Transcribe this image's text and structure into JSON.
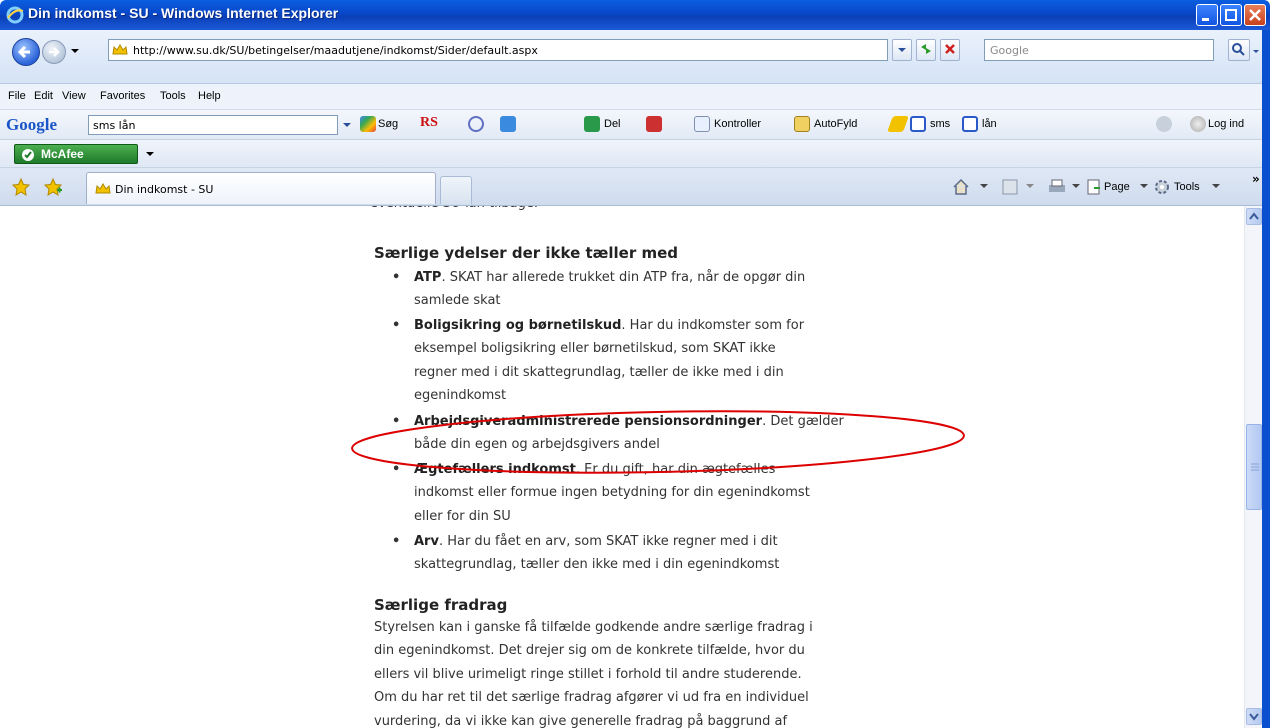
{
  "window": {
    "title": "Din indkomst - SU - Windows Internet Explorer"
  },
  "addressbar": {
    "url": "http://www.su.dk/SU/betingelser/maadutjene/indkomst/Sider/default.aspx",
    "search_placeholder": "Google"
  },
  "menubar": {
    "items": [
      "File",
      "Edit",
      "View",
      "Favorites",
      "Tools",
      "Help"
    ]
  },
  "google_toolbar": {
    "logo": "Google",
    "query": "sms lån",
    "items": [
      "Søg",
      "RS",
      "Del",
      "Kontroller",
      "AutoFyld",
      "sms",
      "lån",
      "Log ind"
    ]
  },
  "mcafee": {
    "label": "McAfee"
  },
  "tabs": {
    "active_label": "Din indkomst - SU"
  },
  "commandbar": {
    "page_label": "Page",
    "tools_label": "Tools"
  },
  "article": {
    "cut_line": "eventuelle SU-lån tilbage.",
    "section1_title": "Særlige ydelser der ikke tæller med",
    "bullets": [
      {
        "bold": "ATP",
        "lines": [
          ". SKAT har allerede trukket din ATP fra, når de opgør din",
          "samlede skat"
        ]
      },
      {
        "bold": "Boligsikring og børnetilskud",
        "lines": [
          ". Har du indkomster som for",
          "eksempel boligsikring eller børnetilskud, som SKAT ikke",
          "regner med i dit skattegrundlag, tæller de ikke med i din",
          "egenindkomst"
        ]
      },
      {
        "bold": "Arbejdsgiveradministrerede pensionsordninger",
        "lines": [
          ". Det gælder",
          "både din egen og arbejdsgivers andel"
        ]
      },
      {
        "bold": "Ægtefællers indkomst",
        "lines": [
          ". Er du gift, har din ægtefælles",
          "indkomst eller formue ingen betydning for din egenindkomst",
          "eller for din SU"
        ]
      },
      {
        "bold": "Arv",
        "lines": [
          ". Har du fået en arv, som SKAT ikke regner med i dit",
          "skattegrundlag, tæller den ikke med i din egenindkomst"
        ]
      }
    ],
    "section2_title": "Særlige fradrag",
    "section2_lines": [
      "Styrelsen kan i ganske få tilfælde godkende andre særlige fradrag i",
      "din egenindkomst. Det drejer sig om de konkrete tilfælde, hvor du",
      "ellers vil blive urimeligt ringe stillet i forhold til andre studerende.",
      "Om du har ret til det særlige fradrag afgører vi ud fra en individuel",
      "vurdering, da vi ikke kan give generelle fradrag på baggrund af"
    ]
  },
  "colors": {
    "titlebar": "#0a4fd0",
    "annotation_oval": "#dd0000",
    "text": "#333333"
  }
}
